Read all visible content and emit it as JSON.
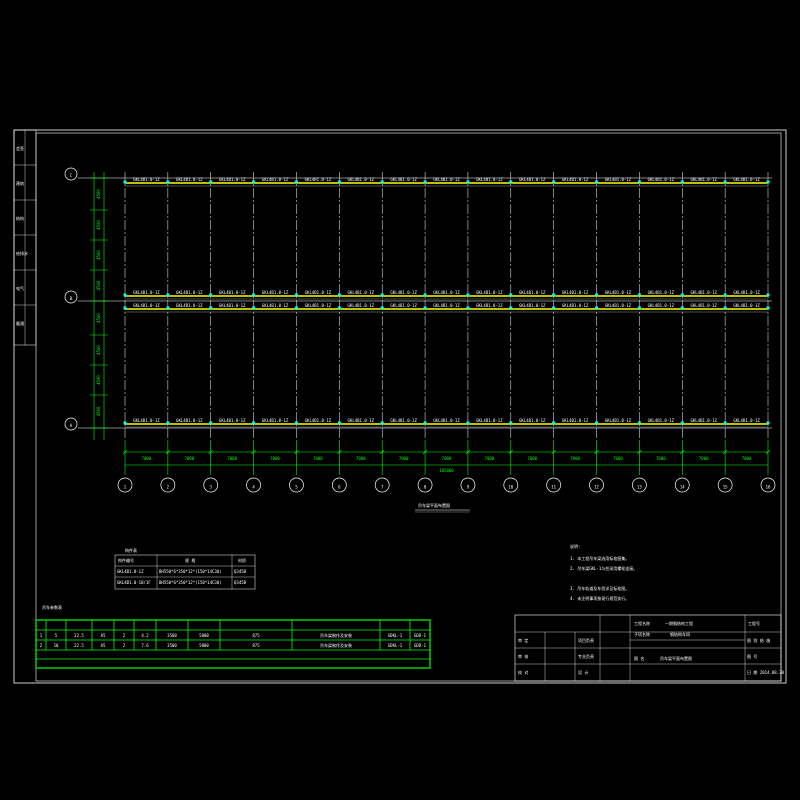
{
  "drawing": {
    "colors": {
      "background": "#000000",
      "frame": "#ffffff",
      "axis": "#00ff00",
      "beam": "#ffff00",
      "support": "#00ffff",
      "dimension": "#00ff00"
    },
    "row_axes": [
      "C",
      "B",
      "A"
    ],
    "column_axes": [
      "1",
      "2",
      "3",
      "4",
      "5",
      "6",
      "7",
      "8",
      "9",
      "10",
      "11",
      "12",
      "13",
      "14",
      "15",
      "16"
    ],
    "total_length": "105000",
    "bay_dimension": "7000",
    "side_dimensions": [
      "4500",
      "4500",
      "4500",
      "4500",
      "4500",
      "4500",
      "4500",
      "4500"
    ],
    "beam_label": "GKL4B1.0-1Z",
    "plan_title": "吊车梁平面布置图"
  },
  "member_table": {
    "title": "构件表",
    "headers": [
      "构件编号",
      "规 格",
      "材质"
    ],
    "rows": [
      [
        "GKL4B1.0-1Z",
        "BH550*6*350*12*(150*14C30)",
        "Q345B"
      ],
      [
        "GKL4B1.0-1B/1F",
        "BH550*6*350*12*(150*14C30)",
        "Q345B"
      ]
    ]
  },
  "crane_table": {
    "title": "吊车参数表",
    "rows": [
      [
        "1",
        "5",
        "22.5",
        "A5",
        "2",
        "4.2",
        "3500",
        "5000",
        "875",
        "吊车梁制作及安装",
        "GDKL-1",
        "GDD-1"
      ],
      [
        "2",
        "10",
        "22.5",
        "A5",
        "2",
        "7.6",
        "3500",
        "5000",
        "875",
        "吊车梁制作及安装",
        "GDKL-1",
        "GDD-1"
      ]
    ]
  },
  "notes": {
    "title": "说明:",
    "items": [
      "1. 本工程吊车梁选用标准图集。",
      "2. 吊车梁GKL-1与柱采用螺栓连接。",
      "3. 吊车轨道及车挡详见标准图。",
      "4. 未注明事项按现行规范执行。"
    ]
  },
  "title_block": {
    "project_label": "工程名称",
    "project_name": "一期钢结构工程",
    "sub_label": "子项名称",
    "sub_name": "钢结构车间",
    "drawing_label": "图 名",
    "drawing_name": "吊车梁平面布置图",
    "number_label": "工程号",
    "roles": [
      "审 定",
      "审 核",
      "校 对",
      "设 计"
    ],
    "role_values": [
      "项目负责",
      "专业负责",
      "",
      ""
    ],
    "right_rows": [
      "图 别 结 施",
      "图 号",
      "日 期 2014.08.30"
    ]
  },
  "left_strip": {
    "labels": [
      "会签",
      "建筑",
      "结构",
      "给排水",
      "电气",
      "暖通"
    ]
  }
}
